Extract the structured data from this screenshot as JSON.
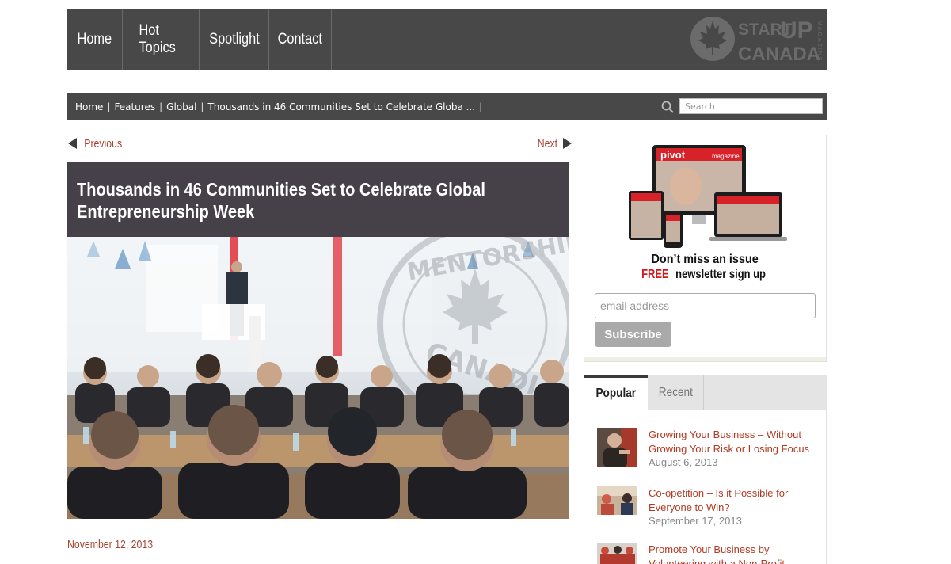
{
  "nav": {
    "items": [
      {
        "label": "Home"
      },
      {
        "label": "Hot Topics"
      },
      {
        "label": "Spotlight"
      },
      {
        "label": "Contact"
      }
    ]
  },
  "logo": {
    "start": "START",
    "up": "UP",
    "canada": "CANADA",
    "magazine": "MAGAZINE"
  },
  "breadcrumb": {
    "items": [
      "Home",
      "Features",
      "Global",
      "Thousands in 46 Communities Set to Celebrate Globa ..."
    ],
    "separator": "|"
  },
  "search": {
    "placeholder": "Search"
  },
  "pager": {
    "previous": "Previous",
    "next": "Next"
  },
  "article": {
    "title": "Thousands in 46 Communities Set to Celebrate Global Entrepreneurship Week",
    "date": "November 12, 2013",
    "watermark_text": "MENTORSHIP CANADIAN CHALLENGE"
  },
  "promo": {
    "line1": "Don’t miss an issue",
    "free": "FREE",
    "line2_rest": " newsletter sign up",
    "email_placeholder": "email address",
    "subscribe_label": "Subscribe",
    "magazine_label": "pivot",
    "magazine_sub": "magazine"
  },
  "sidebar_tabs": {
    "tabs": [
      {
        "label": "Popular",
        "active": true
      },
      {
        "label": "Recent",
        "active": false
      }
    ],
    "posts": [
      {
        "title": "Growing Your Business – Without Growing Your Risk or Losing Focus",
        "date": "August 6, 2013"
      },
      {
        "title": "Co-opetition – Is it Possible for Everyone to Win?",
        "date": "September 17, 2013"
      },
      {
        "title": "Promote Your Business by Volunteering with a Non-Profit",
        "date": ""
      }
    ]
  },
  "colors": {
    "nav_bg": "#484848",
    "title_bg": "#464049",
    "link_red": "#b23a22",
    "free_red": "#d2191d"
  }
}
